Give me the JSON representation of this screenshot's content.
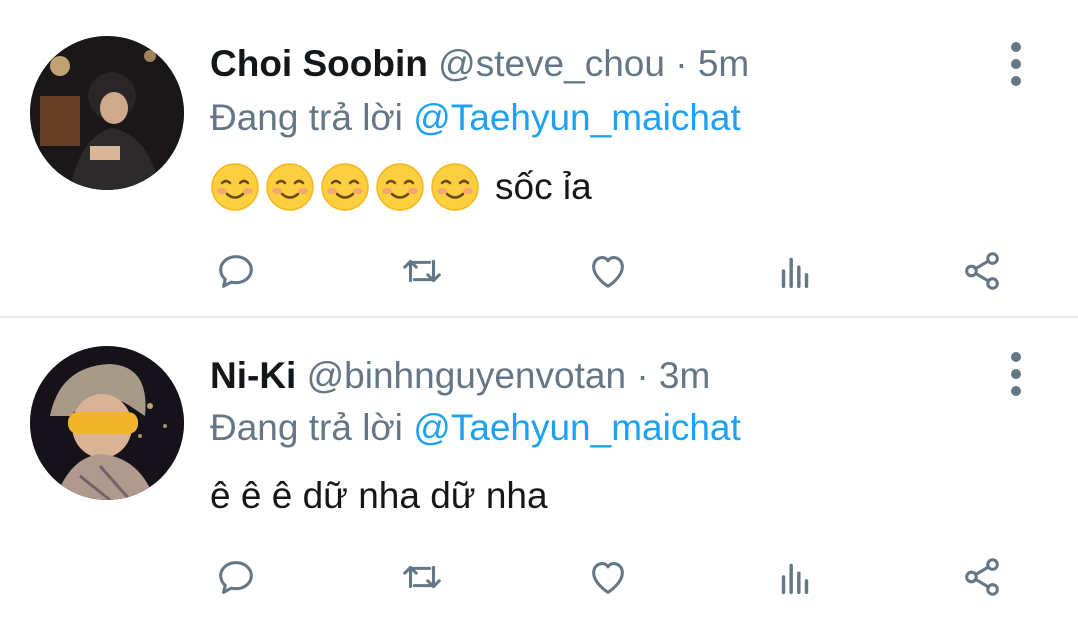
{
  "tweets": [
    {
      "name": "Choi Soobin",
      "handle": "@steve_chou",
      "separator": "·",
      "time": "5m",
      "reply_prefix": "Đang trả lời",
      "reply_mention": "@Taehyun_maichat",
      "emojis": [
        "smiling-face-emoji",
        "smiling-face-emoji",
        "smiling-face-emoji",
        "smiling-face-emoji",
        "smiling-face-emoji"
      ],
      "text": "sốc ỉa"
    },
    {
      "name": "Ni-Ki",
      "handle": "@binhnguyenvotan",
      "separator": "·",
      "time": "3m",
      "reply_prefix": "Đang trả lời",
      "reply_mention": "@Taehyun_maichat",
      "emojis": [],
      "text": "ê ê ê dữ nha dữ nha"
    }
  ],
  "icons": {
    "reply": "reply-icon",
    "retweet": "retweet-icon",
    "like": "heart-icon",
    "analytics": "analytics-icon",
    "share": "share-icon",
    "more": "more-vertical-icon"
  },
  "colors": {
    "name": "#14171a",
    "secondary": "#657786",
    "mention": "#1da1f2",
    "divider": "#e6ecf0",
    "icon": "#657786"
  }
}
